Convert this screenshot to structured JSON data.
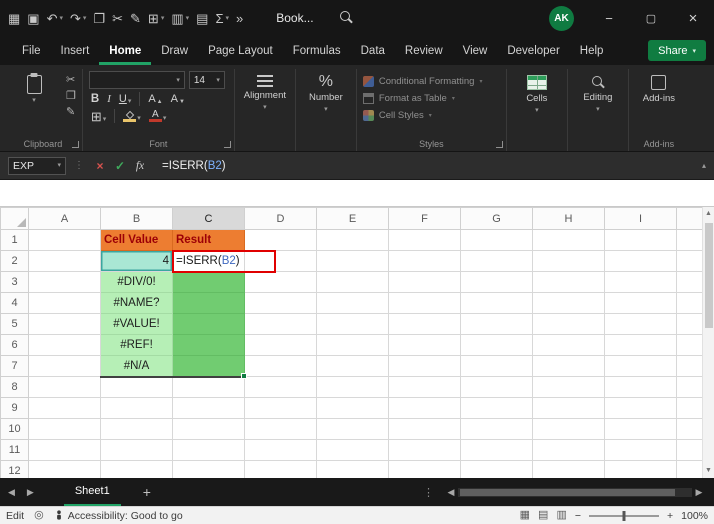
{
  "colors": {
    "accent_green": "#107C41",
    "tab_underline": "#21A366",
    "orange_fill": "#ED7D31",
    "orange_text": "#9C0006",
    "light_green_fill": "#B6EFB6",
    "mid_green_fill": "#71CC71",
    "reference_fill": "#A9E7D4",
    "annotation_red": "#E00000"
  },
  "icons": {
    "dropdown": "▾",
    "chevron_up": "▴",
    "dots_v": "⋮",
    "nav_left": "◀",
    "nav_right": "▶",
    "up": "▲",
    "down": "▼",
    "cut": "✂",
    "copy": "❐",
    "format_painter": "✎",
    "borders": "⊞",
    "percent": "%",
    "view_normal": "▦",
    "view_layout": "▤",
    "view_break": "▥",
    "macro": "◎"
  },
  "window": {
    "title": "Book...",
    "avatar_initials": "AK",
    "minimize": "−",
    "maximize": "▢",
    "close": "×"
  },
  "titlebar": {
    "qat": [
      {
        "name": "apps-grid",
        "glyph": "▦",
        "dropdown": false
      },
      {
        "name": "save",
        "glyph": "▣",
        "dropdown": false
      },
      {
        "name": "undo",
        "glyph": "↶",
        "dropdown": true
      },
      {
        "name": "redo",
        "glyph": "↷",
        "dropdown": true
      },
      {
        "name": "copy",
        "glyph": "❐",
        "dropdown": false
      },
      {
        "name": "cut",
        "glyph": "✂",
        "dropdown": false
      },
      {
        "name": "format-painter",
        "glyph": "✎",
        "dropdown": false
      },
      {
        "name": "insert-table",
        "glyph": "⊞",
        "dropdown": true
      },
      {
        "name": "insert-chart",
        "glyph": "▥",
        "dropdown": true
      },
      {
        "name": "merge-cells",
        "glyph": "▤",
        "dropdown": false
      },
      {
        "name": "autosum",
        "glyph": "Σ",
        "dropdown": true
      },
      {
        "name": "overflow",
        "glyph": "»",
        "dropdown": false
      }
    ]
  },
  "menu": {
    "tabs": [
      "File",
      "Insert",
      "Home",
      "Draw",
      "Page Layout",
      "Formulas",
      "Data",
      "Review",
      "View",
      "Developer",
      "Help"
    ],
    "active_index": 2,
    "share_label": "Share"
  },
  "ribbon": {
    "clipboard_label": "Clipboard",
    "font_label": "Font",
    "font_name_value": "",
    "font_size_value": "14",
    "bold": "B",
    "italic": "I",
    "underline": "U",
    "grow_font": "A",
    "shrink_font": "A",
    "font_color_letter": "A",
    "alignment_label": "Alignment",
    "number_label": "Number",
    "styles_label": "Styles",
    "styles_items": [
      {
        "name": "conditional-formatting",
        "label": "Conditional Formatting"
      },
      {
        "name": "format-as-table",
        "label": "Format as Table"
      },
      {
        "name": "cell-styles",
        "label": "Cell Styles"
      }
    ],
    "cells_label": "Cells",
    "editing_label": "Editing",
    "addins_label": "Add-ins",
    "addins_group_label": "Add-ins"
  },
  "formula_bar": {
    "name_box_value": "EXP",
    "cancel_glyph": "×",
    "enter_glyph": "✓",
    "fx_glyph": "fx",
    "formula_parts": [
      "=ISERR(",
      "B2",
      ")"
    ]
  },
  "grid": {
    "columns": [
      "A",
      "B",
      "C",
      "D",
      "E",
      "F",
      "G",
      "H",
      "I"
    ],
    "row_count": 12,
    "active_column": "C",
    "cells": [
      {
        "ref": "B1",
        "text": "Cell Value",
        "style": "orange-header",
        "align": "left"
      },
      {
        "ref": "C1",
        "text": "Result",
        "style": "orange-header",
        "align": "left"
      },
      {
        "ref": "B2",
        "text": "4",
        "style": "ref-cell",
        "align": "right"
      },
      {
        "ref": "C2",
        "style": "editing-cell",
        "formula": true,
        "align": "left"
      },
      {
        "ref": "B3",
        "text": "#DIV/0!",
        "style": "light-green",
        "align": "center"
      },
      {
        "ref": "B4",
        "text": "#NAME?",
        "style": "light-green",
        "align": "center"
      },
      {
        "ref": "B5",
        "text": "#VALUE!",
        "style": "light-green",
        "align": "center"
      },
      {
        "ref": "B6",
        "text": "#REF!",
        "style": "light-green",
        "align": "center"
      },
      {
        "ref": "B7",
        "text": "#N/A",
        "style": "light-green",
        "align": "center",
        "edge_bottom": true
      },
      {
        "ref": "C3",
        "style": "mid-green"
      },
      {
        "ref": "C4",
        "style": "mid-green"
      },
      {
        "ref": "C5",
        "style": "mid-green"
      },
      {
        "ref": "C6",
        "style": "mid-green"
      },
      {
        "ref": "C7",
        "style": "mid-green",
        "edge_bottom": true,
        "fill_handle": true
      }
    ]
  },
  "sheet_bar": {
    "tabs": [
      {
        "label": "Sheet1",
        "active": true
      }
    ],
    "add_glyph": "+"
  },
  "status_bar": {
    "mode": "Edit",
    "accessibility": "Accessibility: Good to go",
    "zoom_minus": "−",
    "zoom_plus": "+",
    "zoom": "100%"
  }
}
